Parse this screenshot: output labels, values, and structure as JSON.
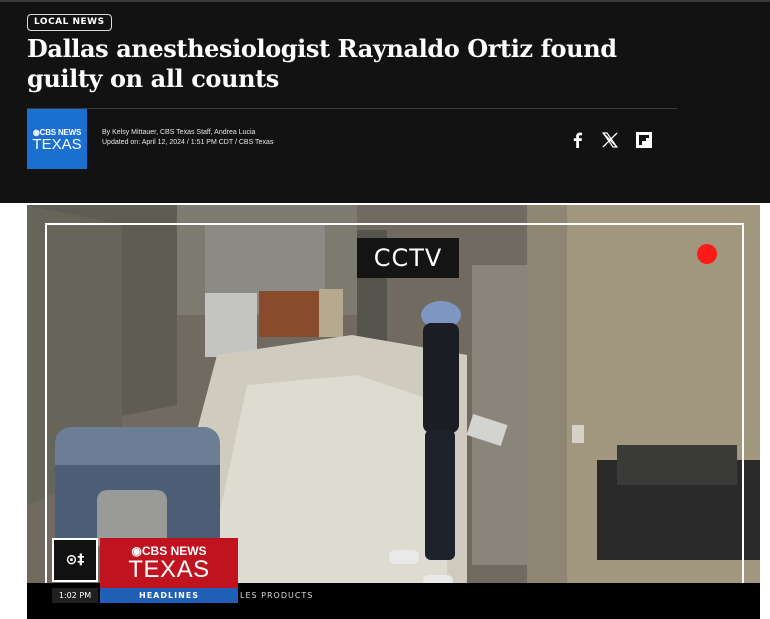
{
  "article": {
    "category": "LOCAL NEWS",
    "title": "Dallas anesthesiologist Raynaldo Ortiz found guilty on all counts",
    "authors": "By Kelsy Mittauer, CBS Texas Staff, Andrea Lucia",
    "updated": "Updated on: April 12, 2024 / 1:51 PM CDT / CBS Texas"
  },
  "logo": {
    "line1": "◉CBS NEWS",
    "line2": "TEXAS",
    "color": "#1a6fd0"
  },
  "share": [
    {
      "icon": "facebook-icon"
    },
    {
      "icon": "x-icon"
    },
    {
      "icon": "flipboard-icon"
    }
  ],
  "video": {
    "cctv_label": "CCTV",
    "station_bug": "⊙‡",
    "brand_line1": "◉CBS NEWS",
    "brand_line2": "TEXAS",
    "time": "1:02 PM",
    "segment": "HEADLINES",
    "ticker": "LES PRODUCTS",
    "brand_color": "#c1121f",
    "segment_color": "#1f5fb5",
    "rec_color": "#ff1a1a"
  }
}
